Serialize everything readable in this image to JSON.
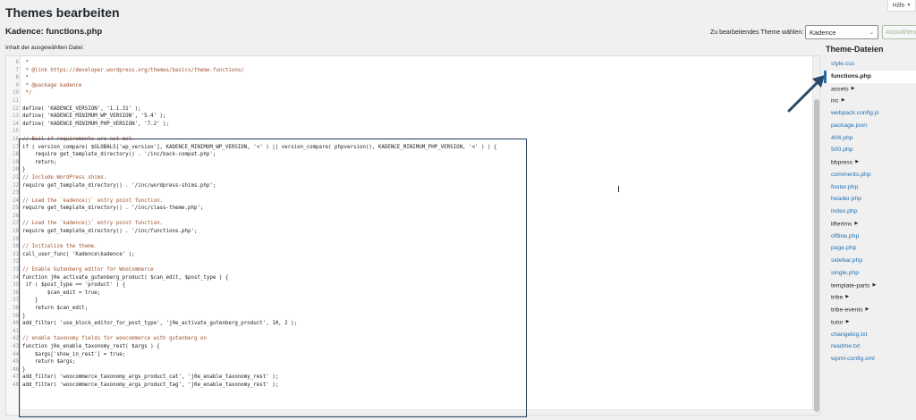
{
  "header": {
    "page_title": "Themes bearbeiten",
    "help_label": "Hilfe",
    "file_title": "Kadence: functions.php",
    "select_label": "Zu bearbeitendes Theme wählen:",
    "selected_theme": "Kadence",
    "select_button": "Auswählen"
  },
  "editor": {
    "content_label": "Inhalt der ausgewählten Datei:",
    "lines": [
      {
        "n": "6",
        "t": " *",
        "c": true
      },
      {
        "n": "7",
        "t": " * @link https://developer.wordpress.org/themes/basics/theme-functions/",
        "c": true
      },
      {
        "n": "8",
        "t": " *",
        "c": true
      },
      {
        "n": "9",
        "t": " * @package kadence",
        "c": true
      },
      {
        "n": "10",
        "t": " */",
        "c": true
      },
      {
        "n": "11",
        "t": "",
        "c": false
      },
      {
        "n": "12",
        "t": "define( 'KADENCE_VERSION', '1.1.31' );",
        "c": false
      },
      {
        "n": "13",
        "t": "define( 'KADENCE_MINIMUM_WP_VERSION', '5.4' );",
        "c": false
      },
      {
        "n": "14",
        "t": "define( 'KADENCE_MINIMUM_PHP_VERSION', '7.2' );",
        "c": false
      },
      {
        "n": "15",
        "t": "",
        "c": false
      },
      {
        "n": "16",
        "t": "// Bail if requirements are not met.",
        "c": true
      },
      {
        "n": "17",
        "t": "if ( version_compare( $GLOBALS['wp_version'], KADENCE_MINIMUM_WP_VERSION, '<' ) || version_compare( phpversion(), KADENCE_MINIMUM_PHP_VERSION, '<' ) ) {",
        "c": false
      },
      {
        "n": "18",
        "t": "    require get_template_directory() . '/inc/back-compat.php';",
        "c": false
      },
      {
        "n": "19",
        "t": "    return;",
        "c": false
      },
      {
        "n": "20",
        "t": "}",
        "c": false
      },
      {
        "n": "21",
        "t": "// Include WordPress shims.",
        "c": true
      },
      {
        "n": "22",
        "t": "require get_template_directory() . '/inc/wordpress-shims.php';",
        "c": false
      },
      {
        "n": "23",
        "t": "",
        "c": false
      },
      {
        "n": "24",
        "t": "// Load the `kadence()` entry point function.",
        "c": true
      },
      {
        "n": "25",
        "t": "require get_template_directory() . '/inc/class-theme.php';",
        "c": false
      },
      {
        "n": "26",
        "t": "",
        "c": false
      },
      {
        "n": "27",
        "t": "// Load the `kadence()` entry point function.",
        "c": true
      },
      {
        "n": "28",
        "t": "require get_template_directory() . '/inc/functions.php';",
        "c": false
      },
      {
        "n": "29",
        "t": "",
        "c": false
      },
      {
        "n": "30",
        "t": "// Initialize the theme.",
        "c": true
      },
      {
        "n": "31",
        "t": "call_user_func( 'Kadence\\kadence' );",
        "c": false
      },
      {
        "n": "32",
        "t": "",
        "c": false
      },
      {
        "n": "33",
        "t": "// Enable Gutenberg editor for WooCommerce",
        "c": true
      },
      {
        "n": "34",
        "t": "function j0e_activate_gutenberg_product( $can_edit, $post_type ) {",
        "c": false
      },
      {
        "n": "35",
        "t": " if ( $post_type == 'product' ) {",
        "c": false
      },
      {
        "n": "36",
        "t": "        $can_edit = true;",
        "c": false
      },
      {
        "n": "37",
        "t": "    }",
        "c": false
      },
      {
        "n": "38",
        "t": "    return $can_edit;",
        "c": false
      },
      {
        "n": "39",
        "t": "}",
        "c": false
      },
      {
        "n": "40",
        "t": "add_filter( 'use_block_editor_for_post_type', 'j0e_activate_gutenberg_product', 10, 2 );",
        "c": false
      },
      {
        "n": "41",
        "t": "",
        "c": false
      },
      {
        "n": "42",
        "t": "// enable taxonomy fields for woocommerce with gutenberg on",
        "c": true
      },
      {
        "n": "43",
        "t": "function j0e_enable_taxonomy_rest( $args ) {",
        "c": false
      },
      {
        "n": "44",
        "t": "    $args['show_in_rest'] = true;",
        "c": false
      },
      {
        "n": "45",
        "t": "    return $args;",
        "c": false
      },
      {
        "n": "46",
        "t": "}",
        "c": false
      },
      {
        "n": "47",
        "t": "add_filter( 'woocommerce_taxonomy_args_product_cat', 'j0e_enable_taxonomy_rest' );",
        "c": false
      },
      {
        "n": "48",
        "t": "add_filter( 'woocommerce_taxonomy_args_product_tag', 'j0e_enable_taxonomy_rest' );",
        "c": false
      }
    ]
  },
  "sidebar": {
    "title": "Theme-Dateien",
    "files": [
      {
        "label": "style.css",
        "type": "file",
        "active": false
      },
      {
        "label": "functions.php",
        "type": "file",
        "active": true
      },
      {
        "label": "assets",
        "type": "folder",
        "active": false
      },
      {
        "label": "inc",
        "type": "folder",
        "active": false
      },
      {
        "label": "webpack.config.js",
        "type": "file",
        "active": false
      },
      {
        "label": "package.json",
        "type": "file",
        "active": false
      },
      {
        "label": "404.php",
        "type": "file",
        "active": false
      },
      {
        "label": "500.php",
        "type": "file",
        "active": false
      },
      {
        "label": "bbpress",
        "type": "folder",
        "active": false
      },
      {
        "label": "comments.php",
        "type": "file",
        "active": false
      },
      {
        "label": "footer.php",
        "type": "file",
        "active": false
      },
      {
        "label": "header.php",
        "type": "file",
        "active": false
      },
      {
        "label": "index.php",
        "type": "file",
        "active": false
      },
      {
        "label": "lifterlms",
        "type": "folder",
        "active": false
      },
      {
        "label": "offline.php",
        "type": "file",
        "active": false
      },
      {
        "label": "page.php",
        "type": "file",
        "active": false
      },
      {
        "label": "sidebar.php",
        "type": "file",
        "active": false
      },
      {
        "label": "single.php",
        "type": "file",
        "active": false
      },
      {
        "label": "template-parts",
        "type": "folder",
        "active": false
      },
      {
        "label": "tribe",
        "type": "folder",
        "active": false
      },
      {
        "label": "tribe-events",
        "type": "folder",
        "active": false
      },
      {
        "label": "tutor",
        "type": "folder",
        "active": false
      },
      {
        "label": "changelog.txt",
        "type": "file",
        "active": false
      },
      {
        "label": "readme.txt",
        "type": "file",
        "active": false
      },
      {
        "label": "wpml-config.xml",
        "type": "file",
        "active": false
      }
    ]
  },
  "colors": {
    "accent": "#2271b1",
    "highlight_box": "#1f3b5c",
    "arrow": "#2b4a6b"
  }
}
